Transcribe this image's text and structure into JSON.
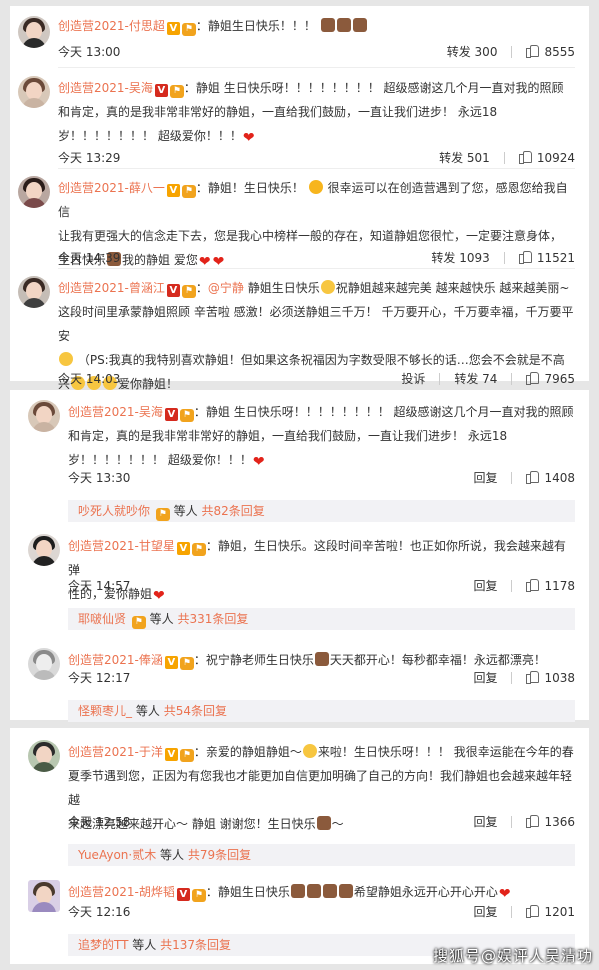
{
  "brand_color": "#eb7350",
  "panel1": {
    "comments": [
      {
        "user": "创造营2021-付思超",
        "prefix": "",
        "text": "静姐生日快乐！！！",
        "time": "今天 13:00",
        "left_action_label": "转发",
        "left_action_count": "300",
        "likes": "8555"
      },
      {
        "user": "创造营2021-吴海",
        "text_line1": "静姐 生日快乐呀！！！！！！！！   超级感谢这几个月一直对我的照顾",
        "text_line2": "和肯定，真的是我非常非常好的静姐，一直给我们鼓励，一直让我们进步！ 永远18",
        "text_line3": "岁！！！！！！！ 超级爱你！！！",
        "time": "今天 13:29",
        "left_action_label": "转发",
        "left_action_count": "501",
        "likes": "10924"
      },
      {
        "user": "创造营2021-薛八一",
        "text_line1": "静姐！生日快乐！",
        "text_line1b": "很幸运可以在创造营遇到了您，感恩您给我自信",
        "text_line2": "让我有更强大的信念走下去，您是我心中榜样一般的存在，知道静姐您很忙，一定要注意身体，",
        "text_line3a": "生日快乐",
        "text_line3b": "我的静姐 爱您",
        "time": "今天 14:39",
        "left_action_label": "转发",
        "left_action_count": "1093",
        "likes": "11521"
      },
      {
        "user": "创造营2021-曾涵江",
        "mention": "@宁静",
        "text_line1a": "静姐生日快乐",
        "text_line1b": "祝静姐越来越完美 越来越快乐 越来越美丽~",
        "text_line2": "这段时间里承蒙静姐照顾 辛苦啦 感激！必须送静姐三千万！ 千万要开心，千万要幸福，千万要平安",
        "text_line3": "（PS:我真的我特别喜欢静姐！但如果这条祝福因为字数受限不够长的话…您会不会就是不高",
        "text_line4a": "兴",
        "text_line4b": "爱你静姐！",
        "time": "今天 14:03",
        "left_action_label": "投诉",
        "mid_action_label": "转发",
        "left_action_count": "74",
        "likes": "7965"
      }
    ]
  },
  "panel2": {
    "comments": [
      {
        "user": "创造营2021-吴海",
        "text_line1": "静姐 生日快乐呀！！！！！！！！   超级感谢这几个月一直对我的照顾",
        "text_line2": "和肯定，真的是我非常非常好的静姐，一直给我们鼓励，一直让我们进步！ 永远18",
        "text_line3": "岁！！！！！！！ 超级爱你！！！",
        "time": "今天 13:30",
        "reply_label": "回复",
        "likes": "1408",
        "sub_who": "吵死人就吵你",
        "sub_mid": "等人",
        "sub_count": "共82条回复"
      },
      {
        "user": "创造营2021-甘望星",
        "text_line1": "静姐，生日快乐。这段时间辛苦啦！也正如你所说，我会越来越有弹",
        "text_line2": "性的，爱你静姐",
        "time": "今天 14:57",
        "reply_label": "回复",
        "likes": "1178",
        "sub_who": "耶啵仙贤",
        "sub_mid": "等人",
        "sub_count": "共331条回复"
      },
      {
        "user": "创造营2021-俸涵",
        "text_line1a": "祝宁静老师生日快乐",
        "text_line1b": "天天都开心！每秒都幸福！永远都漂亮！",
        "time": "今天 12:17",
        "reply_label": "回复",
        "likes": "1038",
        "sub_who": "怪颗枣儿_",
        "sub_mid": "等人",
        "sub_count": "共54条回复"
      }
    ]
  },
  "panel3": {
    "comments": [
      {
        "user": "创造营2021-于洋",
        "text_line1a": "亲爱的静姐静姐～",
        "text_line1b": "来啦！生日快乐呀！！！ 我很幸运能在今年的春",
        "text_line2": "夏季节遇到您，正因为有您我也才能更加自信更加明确了自己的方向！我们静姐也会越来越年轻越",
        "text_line3a": "来越漂亮越来越开心～ 静姐 谢谢您！生日快乐",
        "text_line3b": "～",
        "time": "今天 12:58",
        "reply_label": "回复",
        "likes": "1366",
        "sub_who": "YueAyon·贰木",
        "sub_mid": "等人",
        "sub_count": "共79条回复"
      },
      {
        "user": "创造营2021-胡烨韬",
        "text_line1a": "静姐生日快乐",
        "text_line1b": "希望静姐永远开心开心开心",
        "time": "今天 12:16",
        "reply_label": "回复",
        "likes": "1201",
        "sub_who": "追梦的TT",
        "sub_mid": "等人",
        "sub_count": "共137条回复"
      }
    ]
  },
  "watermark": "搜狐号@娱评人吴清功"
}
